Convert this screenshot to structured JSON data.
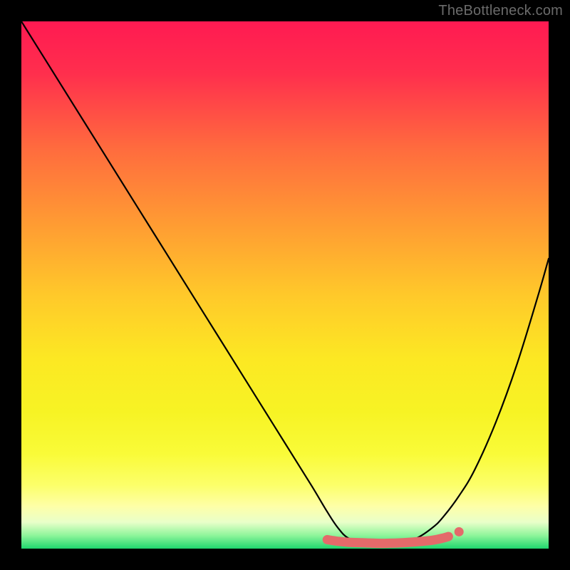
{
  "watermark": "TheBottleneck.com",
  "gradient_stops": [
    {
      "offset": 0.0,
      "color": "#ff1a52"
    },
    {
      "offset": 0.1,
      "color": "#ff2f4d"
    },
    {
      "offset": 0.24,
      "color": "#ff6b3e"
    },
    {
      "offset": 0.38,
      "color": "#ff9a33"
    },
    {
      "offset": 0.52,
      "color": "#ffc92a"
    },
    {
      "offset": 0.64,
      "color": "#fce823"
    },
    {
      "offset": 0.74,
      "color": "#f7f324"
    },
    {
      "offset": 0.82,
      "color": "#f9fb38"
    },
    {
      "offset": 0.88,
      "color": "#fcff6a"
    },
    {
      "offset": 0.92,
      "color": "#feffa8"
    },
    {
      "offset": 0.95,
      "color": "#e9ffc9"
    },
    {
      "offset": 0.975,
      "color": "#8ef59a"
    },
    {
      "offset": 1.0,
      "color": "#1fd66e"
    }
  ],
  "chart_data": {
    "type": "line",
    "title": "",
    "xlabel": "",
    "ylabel": "",
    "xlim": [
      0,
      100
    ],
    "ylim": [
      0,
      100
    ],
    "grid": false,
    "series": [
      {
        "name": "curve",
        "color": "#000000",
        "x": [
          0,
          5,
          10,
          15,
          20,
          25,
          30,
          35,
          40,
          45,
          50,
          55,
          58,
          60,
          62,
          65,
          68,
          72,
          75,
          78,
          80,
          83,
          86,
          90,
          94,
          98,
          100
        ],
        "y": [
          100,
          92,
          84,
          76,
          68,
          60,
          52,
          44,
          36,
          28,
          20,
          12,
          7,
          4,
          2,
          1.2,
          1,
          1.2,
          2,
          4,
          6,
          10,
          15,
          24,
          35,
          48,
          55
        ]
      },
      {
        "name": "highlight-band",
        "color": "#e46a6a",
        "x": [
          58,
          60,
          62,
          65,
          68,
          72,
          75,
          78,
          80,
          81
        ],
        "y": [
          1.7,
          1.4,
          1.2,
          1.1,
          1.0,
          1.1,
          1.3,
          1.6,
          2.0,
          2.3
        ]
      },
      {
        "name": "highlight-dot",
        "color": "#e46a6a",
        "x": [
          83
        ],
        "y": [
          3.2
        ]
      }
    ]
  }
}
